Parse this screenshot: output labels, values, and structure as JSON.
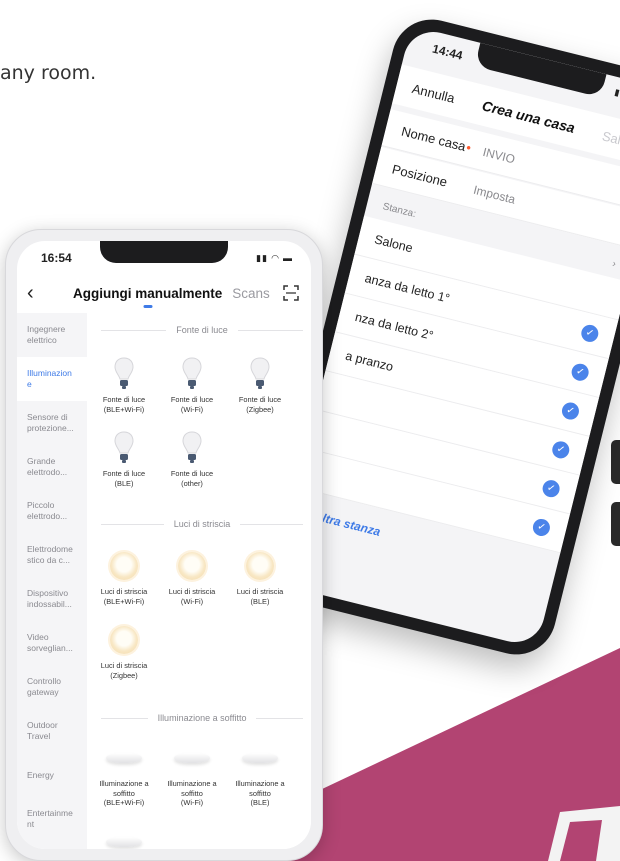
{
  "marketing": {
    "headline_fragment": "any room."
  },
  "brand": {
    "accent": "#3f7be7",
    "magenta": "#b24472",
    "required": "#ff5a2e"
  },
  "back_phone": {
    "time": "14:44",
    "nav": {
      "cancel": "Annulla",
      "title": "Crea una casa",
      "save": "Salvare"
    },
    "form": {
      "name_label": "Nome casa",
      "name_required": "•",
      "name_value": "INVIO",
      "location_label": "Posizione",
      "location_value": "Imposta"
    },
    "rooms_header": "Stanza:",
    "rooms_chevron": "›",
    "rooms": [
      "Salone",
      "anza da letto 1°",
      "nza da letto 2°",
      "a pranzo",
      "",
      ""
    ],
    "add_room": "n'altra stanza"
  },
  "front_phone": {
    "time": "16:54",
    "nav": {
      "back": "‹",
      "tab_active": "Aggiungi manualmente",
      "tab_other": "Scans"
    },
    "sidebar": [
      "Ingegnere elettrico",
      "Illuminazion e",
      "Sensore di protezione...",
      "Grande elettrodo...",
      "Piccolo elettrodo...",
      "Elettrodome stico da c...",
      "Dispositivo indossabil...",
      "Video sorveglian...",
      "Controllo gateway",
      "Outdoor Travel",
      "Energy",
      "Entertainme nt"
    ],
    "sections": [
      {
        "title": "Fonte di luce",
        "items": [
          {
            "line1": "Fonte di luce",
            "line2": "(BLE+Wi-Fi)"
          },
          {
            "line1": "Fonte di luce",
            "line2": "(Wi-Fi)"
          },
          {
            "line1": "Fonte di luce",
            "line2": "(Zigbee)"
          },
          {
            "line1": "Fonte di luce",
            "line2": "(BLE)"
          },
          {
            "line1": "Fonte di luce",
            "line2": "(other)"
          }
        ]
      },
      {
        "title": "Luci di striscia",
        "items": [
          {
            "line1": "Luci di striscia",
            "line2": "(BLE+Wi-Fi)"
          },
          {
            "line1": "Luci di striscia",
            "line2": "(Wi-Fi)"
          },
          {
            "line1": "Luci di striscia",
            "line2": "(BLE)"
          },
          {
            "line1": "Luci di striscia",
            "line2": "(Zigbee)"
          }
        ]
      },
      {
        "title": "Illuminazione a soffitto",
        "items": [
          {
            "line1": "Illuminazione a soffitto",
            "line2": "(BLE+Wi-Fi)"
          },
          {
            "line1": "Illuminazione a soffitto",
            "line2": "(Wi-Fi)"
          },
          {
            "line1": "Illuminazione a soffitto",
            "line2": "(BLE)"
          }
        ]
      }
    ]
  }
}
